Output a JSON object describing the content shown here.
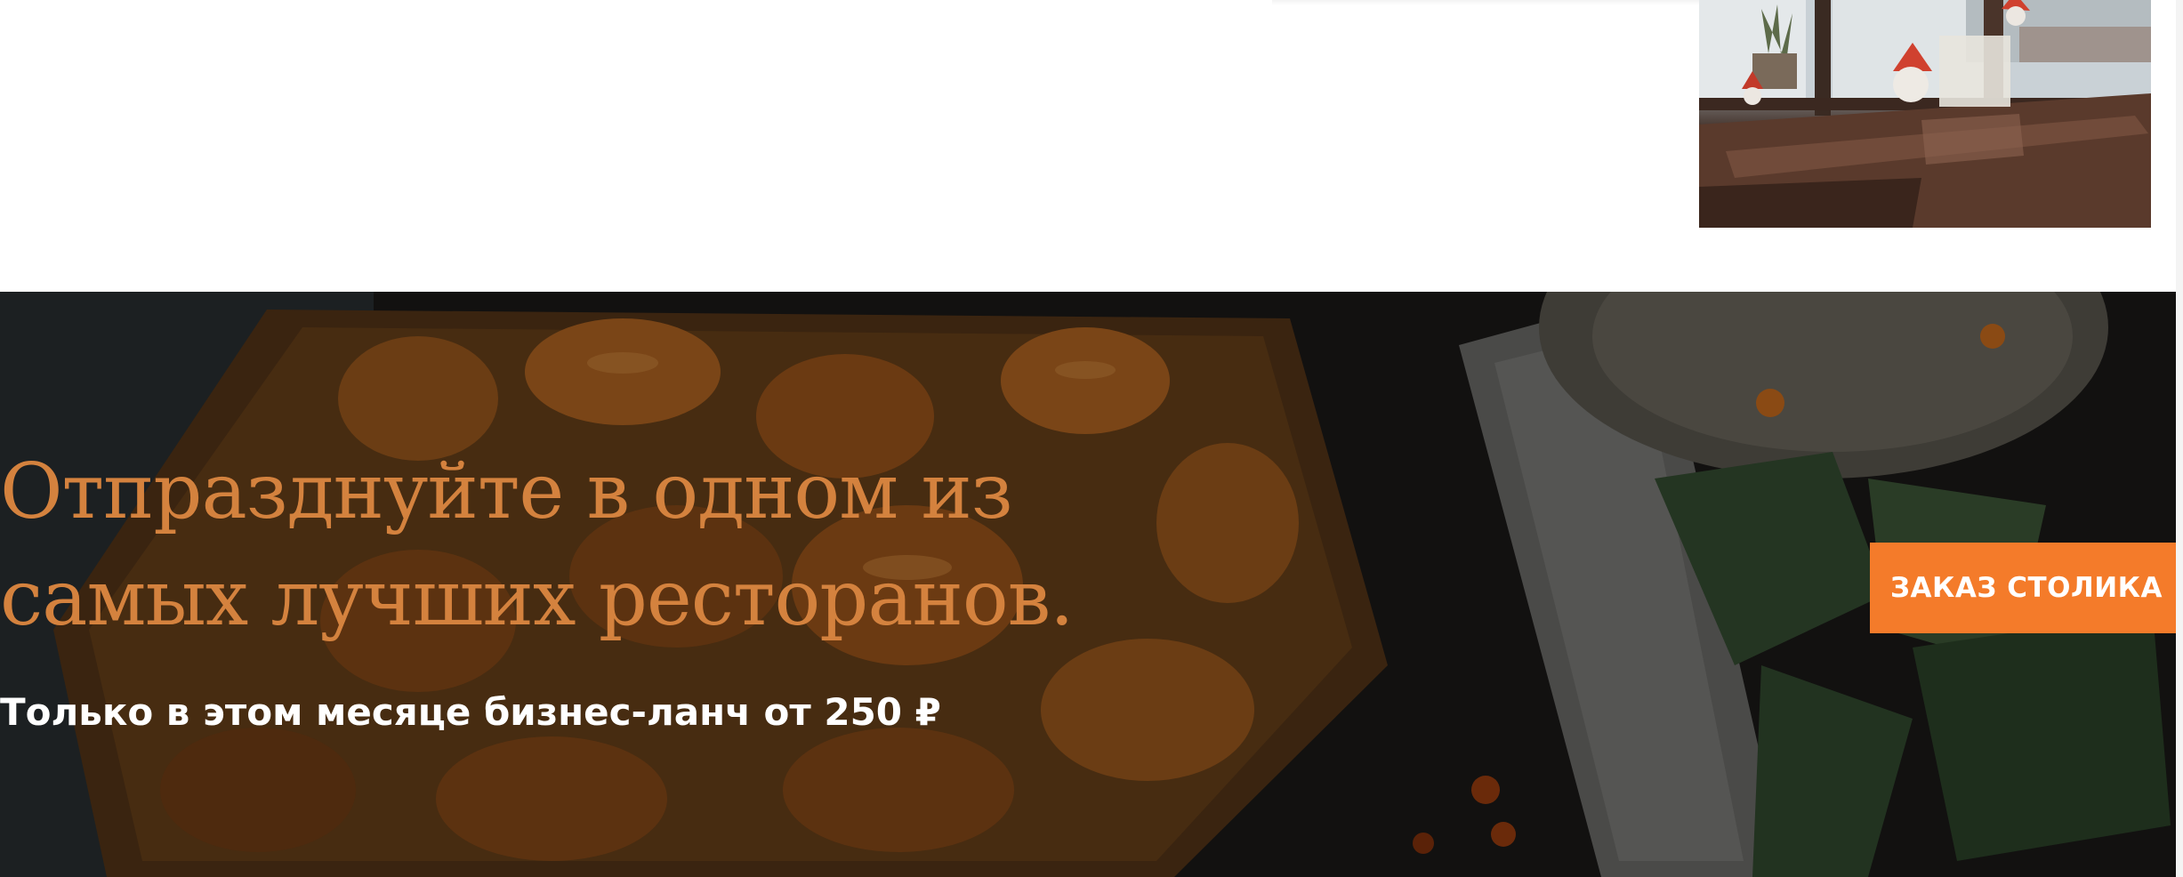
{
  "top_section": {
    "photo_icon": "restaurant-interior-photo"
  },
  "promo": {
    "heading_line1": "Отпразднуйте в одном из",
    "heading_line2": "самых лучших ресторанов.",
    "subheading": "Только в этом месяце бизнес-ланч от 250 ₽",
    "button_label": "ЗАКАЗ СТОЛИКА",
    "background_icon": "food-photo-background"
  },
  "colors": {
    "heading": "#d4823e",
    "button_bg": "#f47b2a",
    "button_text": "#ffffff",
    "banner_bg": "#0f0d0b",
    "subheading": "#ffffff"
  }
}
